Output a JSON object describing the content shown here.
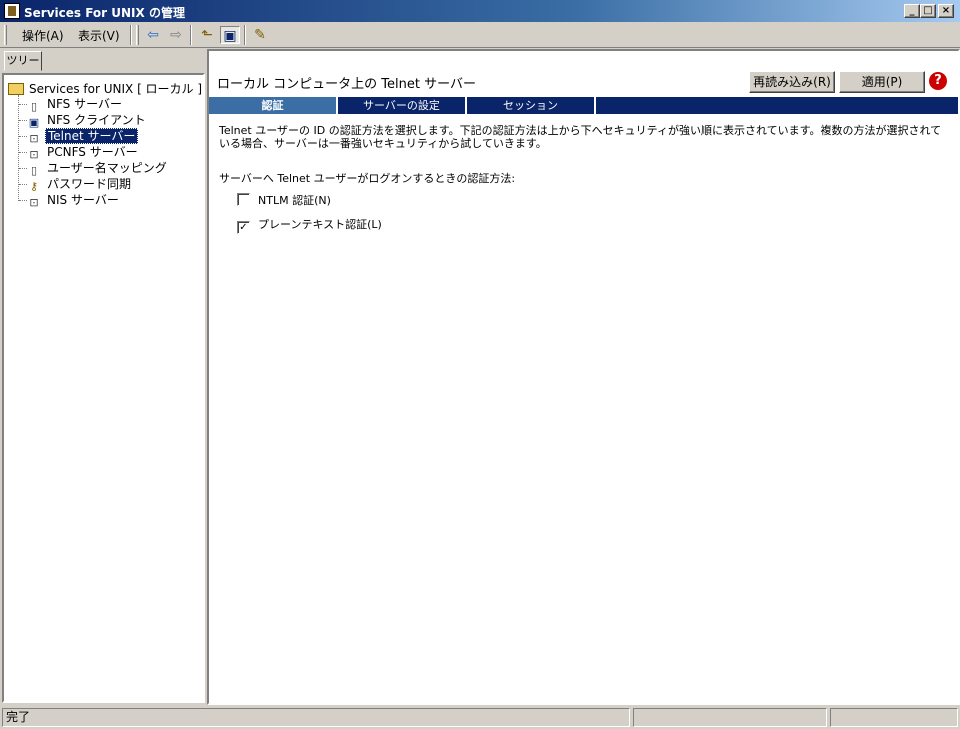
{
  "window": {
    "title": "Services For UNIX の管理",
    "min": "_",
    "max": "□",
    "close": "×"
  },
  "menu": {
    "action": "操作(A)",
    "view": "表示(V)"
  },
  "toolbar": {
    "back": "⇦",
    "forward": "⇨",
    "up": "⬑",
    "tree_toggle": "▣",
    "properties": "✎"
  },
  "tree": {
    "tab_label": "ツリー",
    "root": "Services for UNIX [ ローカル ]",
    "items": [
      {
        "label": "NFS サーバー",
        "icon": "server-icon"
      },
      {
        "label": "NFS クライアント",
        "icon": "computer-icon"
      },
      {
        "label": "Telnet サーバー",
        "icon": "network-computer-icon",
        "selected": true
      },
      {
        "label": "PCNFS サーバー",
        "icon": "network-computer-icon"
      },
      {
        "label": "ユーザー名マッピング",
        "icon": "server-icon"
      },
      {
        "label": "パスワード同期",
        "icon": "key-icon"
      },
      {
        "label": "NIS サーバー",
        "icon": "network-computer-icon"
      }
    ]
  },
  "main": {
    "title": "ローカル コンピュータ上の Telnet サーバー",
    "reload_label": "再読み込み(R)",
    "apply_label": "適用(P)",
    "help": "?",
    "tabs": [
      {
        "label": "認証",
        "active": true
      },
      {
        "label": "サーバーの設定",
        "active": false
      },
      {
        "label": "セッション",
        "active": false
      }
    ],
    "description": "Telnet ユーザーの ID の認証方法を選択します。下記の認証方法は上から下へセキュリティが強い順に表示されています。複数の方法が選択されている場合、サーバーは一番強いセキュリティから試していきます。",
    "method_label": "サーバーへ Telnet ユーザーがログオンするときの認証方法:",
    "options": [
      {
        "label": "NTLM 認証(N)",
        "checked": false
      },
      {
        "label": "プレーンテキスト認証(L)",
        "checked": true
      }
    ]
  },
  "status": {
    "text": "完了"
  }
}
